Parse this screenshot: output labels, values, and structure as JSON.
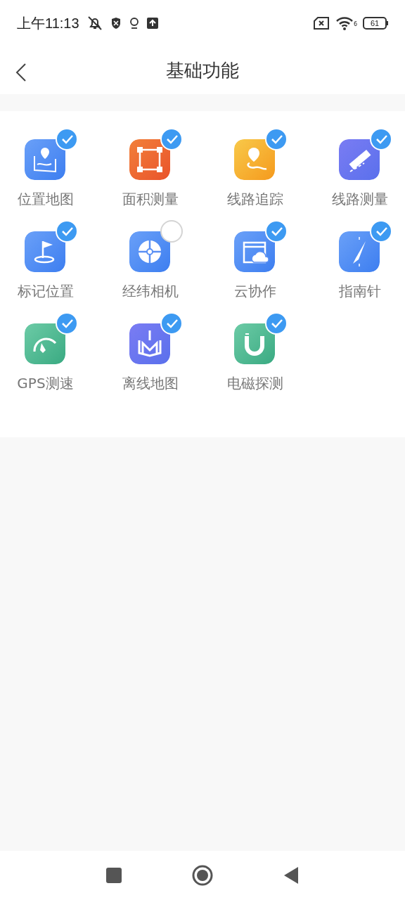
{
  "status_bar": {
    "time": "上午11:13",
    "wifi_label": "6",
    "battery": "61"
  },
  "header": {
    "title": "基础功能"
  },
  "functions": [
    {
      "label": "位置地图",
      "kind": "map",
      "checked": true
    },
    {
      "label": "面积测量",
      "kind": "area",
      "checked": true
    },
    {
      "label": "线路追踪",
      "kind": "track",
      "checked": true
    },
    {
      "label": "线路测量",
      "kind": "ruler",
      "checked": true
    },
    {
      "label": "标记位置",
      "kind": "flag",
      "checked": true
    },
    {
      "label": "经纬相机",
      "kind": "globe",
      "checked": false
    },
    {
      "label": "云协作",
      "kind": "cloud",
      "checked": true
    },
    {
      "label": "指南针",
      "kind": "compass",
      "checked": true
    },
    {
      "label": "GPS测速",
      "kind": "gauge",
      "checked": true
    },
    {
      "label": "离线地图",
      "kind": "download",
      "checked": true
    },
    {
      "label": "电磁探测",
      "kind": "magnet",
      "checked": true
    }
  ]
}
